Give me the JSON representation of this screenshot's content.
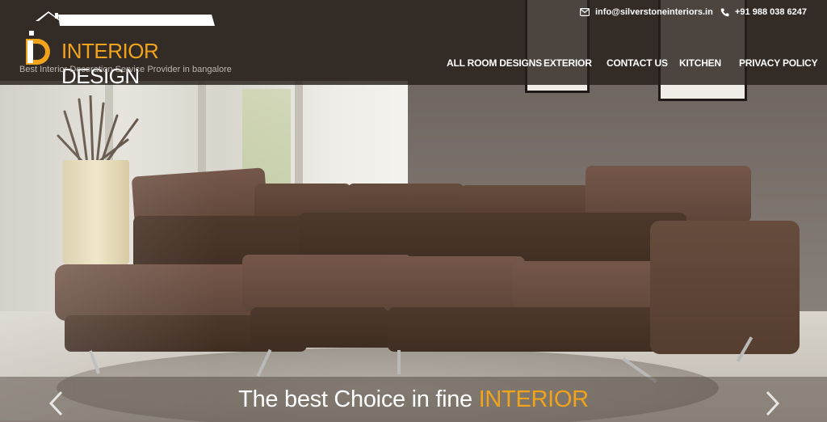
{
  "brand": {
    "word1": "INTERIOR",
    "word2": "DESIGN",
    "tagline": "Best Interior Decoration Service Provider in bangalore",
    "accent_color": "#f2a31c"
  },
  "contact": {
    "email": "info@silverstoneinteriors.in",
    "email_icon": "envelope-icon",
    "phone": "+91 988 038 6247",
    "phone_icon": "phone-icon"
  },
  "nav": {
    "items": [
      {
        "label": "ALL ROOM DESIGNS"
      },
      {
        "label": "EXTERIOR"
      },
      {
        "label": "CONTACT US"
      },
      {
        "label": "KITCHEN"
      },
      {
        "label": "PRIVACY POLICY"
      }
    ]
  },
  "slider": {
    "caption_text": "The best Choice in fine",
    "caption_highlight": "INTERIOR",
    "prev_icon": "chevron-left-icon",
    "next_icon": "chevron-right-icon"
  }
}
